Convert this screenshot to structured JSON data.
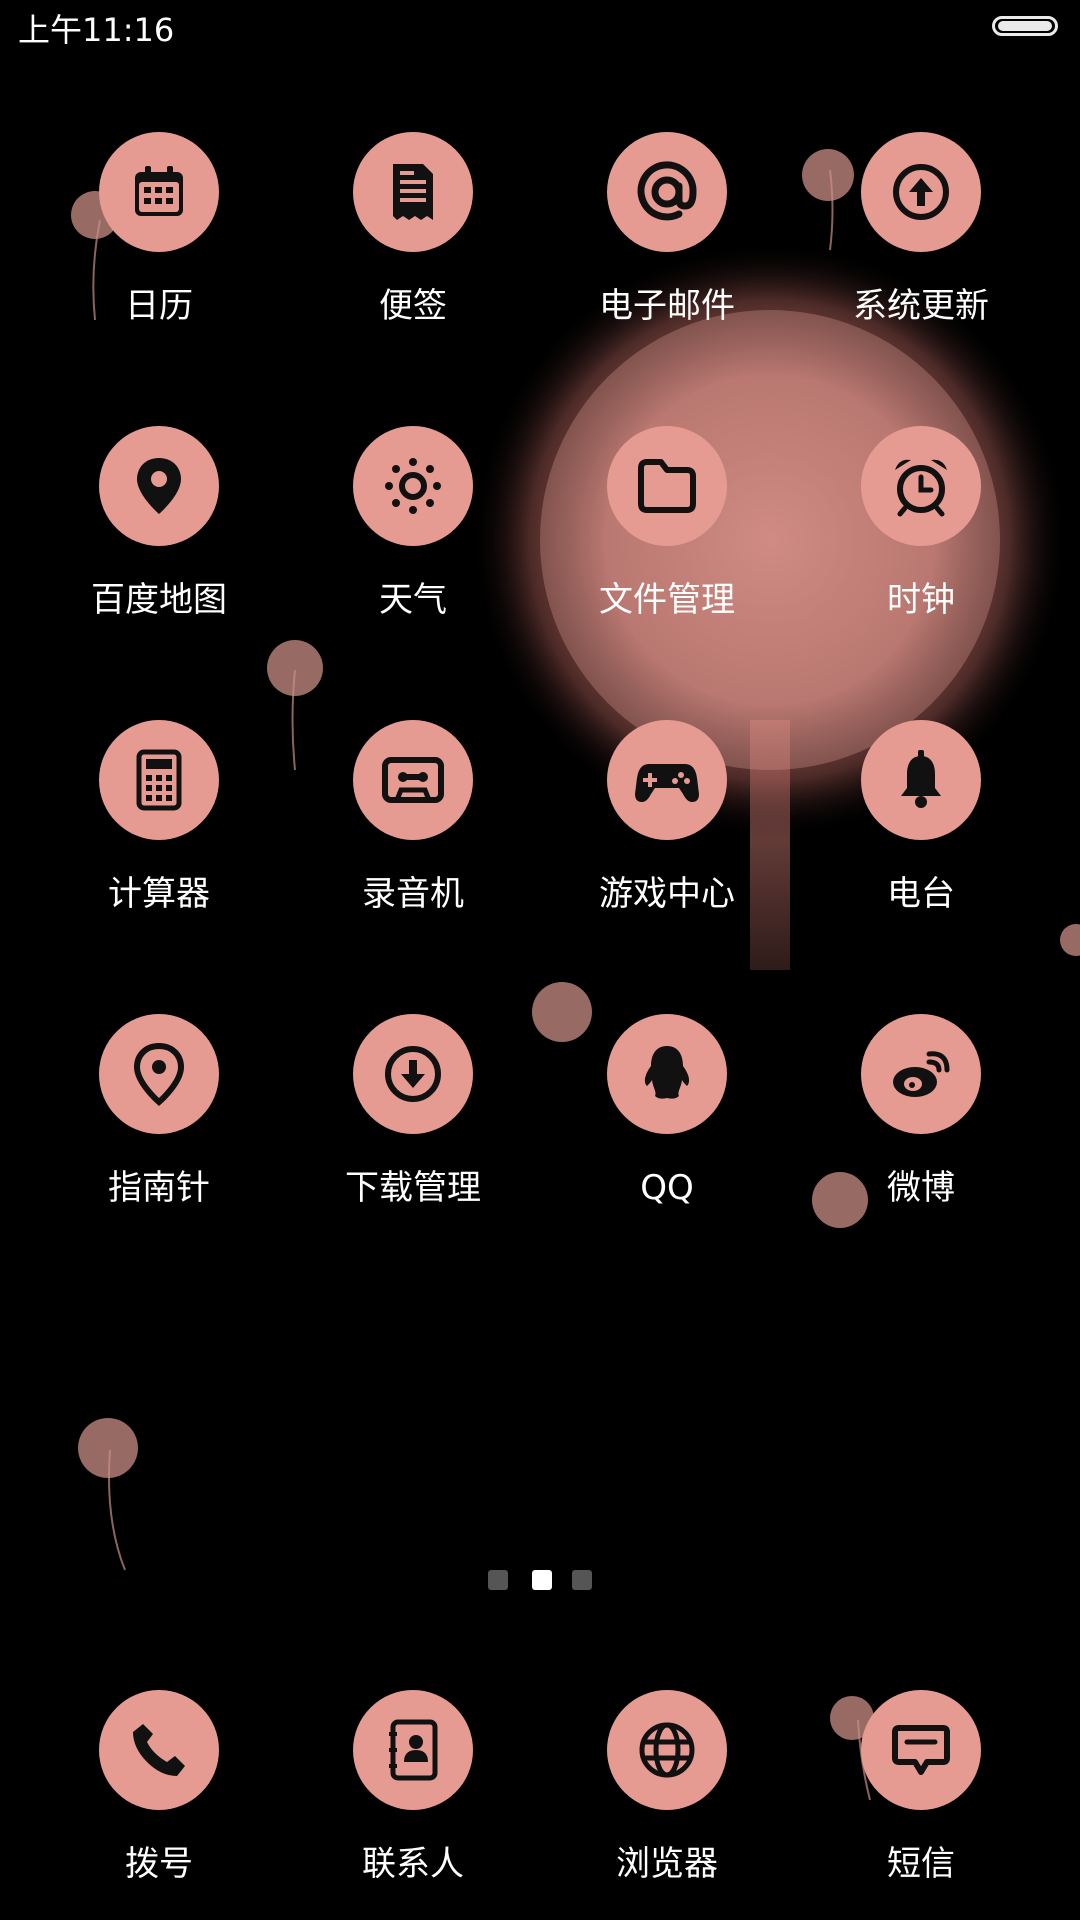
{
  "status_bar": {
    "time": "上午11:16"
  },
  "accent_color": "#e59b92",
  "apps": [
    {
      "label": "日历",
      "icon": "calendar-icon"
    },
    {
      "label": "便签",
      "icon": "note-icon"
    },
    {
      "label": "电子邮件",
      "icon": "email-at-icon"
    },
    {
      "label": "系统更新",
      "icon": "upload-arrow-icon"
    },
    {
      "label": "百度地图",
      "icon": "map-pin-icon"
    },
    {
      "label": "天气",
      "icon": "sun-icon"
    },
    {
      "label": "文件管理",
      "icon": "folder-icon"
    },
    {
      "label": "时钟",
      "icon": "alarm-clock-icon"
    },
    {
      "label": "计算器",
      "icon": "calculator-icon"
    },
    {
      "label": "录音机",
      "icon": "cassette-icon"
    },
    {
      "label": "游戏中心",
      "icon": "gamepad-icon"
    },
    {
      "label": "电台",
      "icon": "bell-icon"
    },
    {
      "label": "指南针",
      "icon": "location-pin-icon"
    },
    {
      "label": "下载管理",
      "icon": "download-icon"
    },
    {
      "label": "QQ",
      "icon": "penguin-icon"
    },
    {
      "label": "微博",
      "icon": "weibo-icon"
    }
  ],
  "page_indicator": {
    "count": 3,
    "active": 2
  },
  "dock": [
    {
      "label": "拨号",
      "icon": "phone-icon"
    },
    {
      "label": "联系人",
      "icon": "contacts-icon"
    },
    {
      "label": "浏览器",
      "icon": "globe-icon"
    },
    {
      "label": "短信",
      "icon": "message-icon"
    }
  ]
}
